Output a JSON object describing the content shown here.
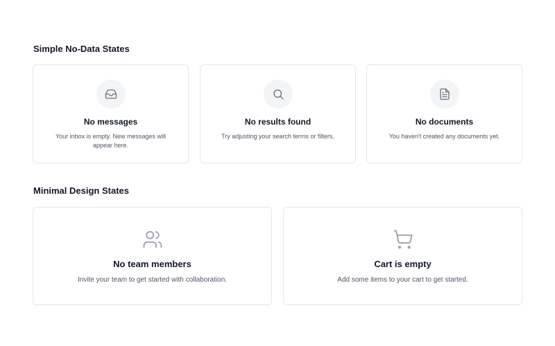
{
  "sections": {
    "simple": {
      "title": "Simple No-Data States",
      "cards": [
        {
          "icon": "inbox-icon",
          "heading": "No messages",
          "description": "Your inbox is empty. New messages will appear here."
        },
        {
          "icon": "search-icon",
          "heading": "No results found",
          "description": "Try adjusting your search terms or filters."
        },
        {
          "icon": "document-icon",
          "heading": "No documents",
          "description": "You haven't created any documents yet."
        }
      ]
    },
    "minimal": {
      "title": "Minimal Design States",
      "cards": [
        {
          "icon": "users-icon",
          "heading": "No team members",
          "description": "Invite your team to get started with collaboration."
        },
        {
          "icon": "shopping-cart-icon",
          "heading": "Cart is empty",
          "description": "Add some items to your cart to get started."
        }
      ]
    }
  },
  "colors": {
    "icon": "#6b7280",
    "icon_light": "#9ca3af",
    "icon_background": "#f3f4f6",
    "border": "#e5e7eb",
    "heading": "#111827",
    "description": "#4b5563"
  }
}
